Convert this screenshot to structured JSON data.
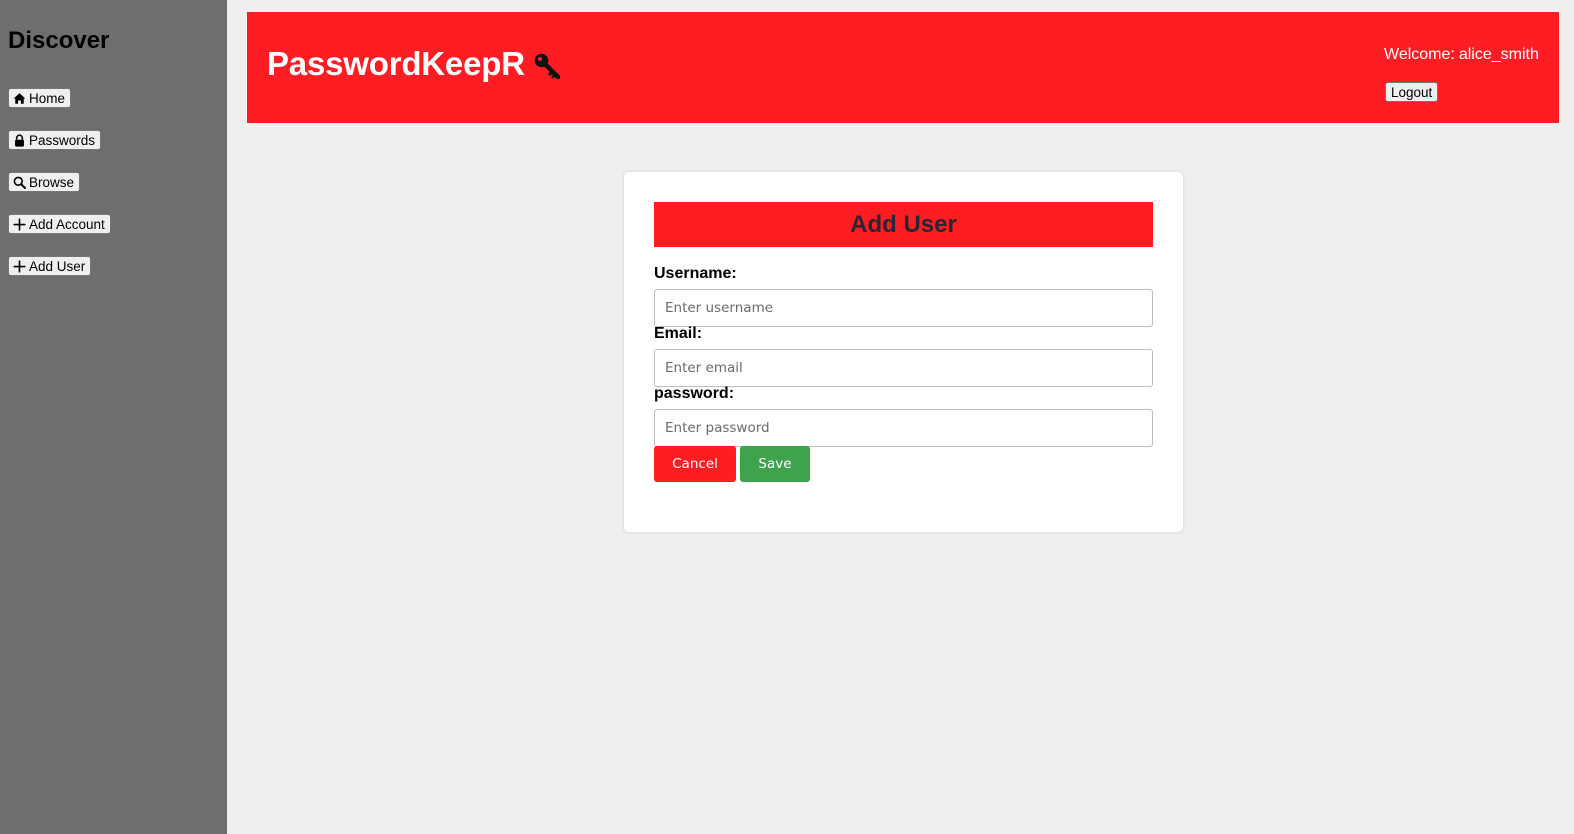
{
  "sidebar": {
    "title": "Discover",
    "items": [
      {
        "label": "Home",
        "icon": "home-icon"
      },
      {
        "label": "Passwords",
        "icon": "lock-icon"
      },
      {
        "label": "Browse",
        "icon": "search-icon"
      },
      {
        "label": "Add Account",
        "icon": "plus-icon"
      },
      {
        "label": "Add User",
        "icon": "plus-icon"
      }
    ]
  },
  "header": {
    "brand": "PasswordKeepR",
    "brand_icon": "key-icon",
    "welcome_prefix": "Welcome:",
    "username": "alice_smith",
    "logout_label": "Logout"
  },
  "form": {
    "title": "Add User",
    "fields": [
      {
        "label": "Username:",
        "placeholder": "Enter username",
        "value": ""
      },
      {
        "label": "Email:",
        "placeholder": "Enter email",
        "value": ""
      },
      {
        "label": "password:",
        "placeholder": "Enter password",
        "value": ""
      }
    ],
    "cancel_label": "Cancel",
    "save_label": "Save"
  },
  "colors": {
    "accent_red": "#ff1d24",
    "save_green": "#3fa34d",
    "sidebar_bg": "#6e6e6e",
    "page_bg": "#efefef"
  }
}
